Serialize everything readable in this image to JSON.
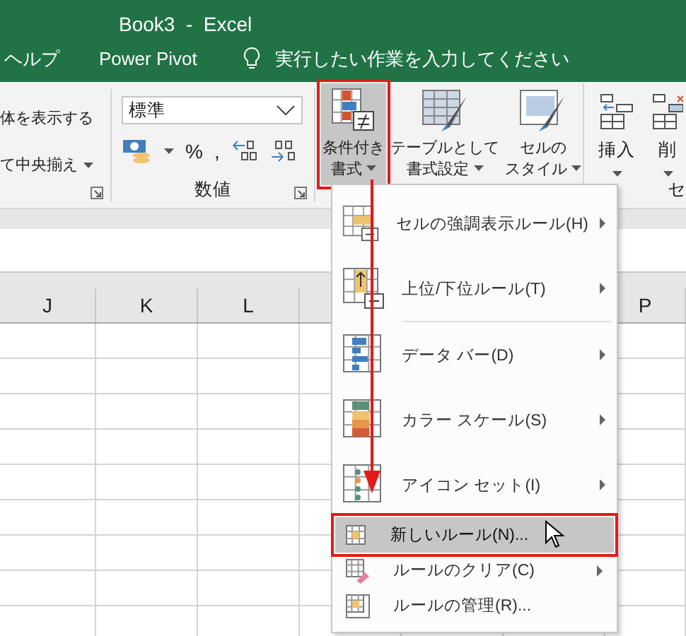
{
  "window": {
    "title": "Book3  -  Excel"
  },
  "tabs": [
    {
      "label": "ヘルプ"
    },
    {
      "label": "Power Pivot"
    }
  ],
  "tell_me": {
    "placeholder": "実行したい作業を入力してください"
  },
  "ribbon": {
    "alignment": {
      "lines": [
        {
          "label": "体を表示する",
          "caret": false
        },
        {
          "label": "て中央揃え",
          "caret": true
        }
      ]
    },
    "number": {
      "format": {
        "value": "標準"
      },
      "buttons": [
        {
          "label": "%",
          "kind": "text"
        },
        {
          "label": ",",
          "kind": "text"
        }
      ],
      "group_label": "数値"
    },
    "styles": [
      {
        "lines": [
          "条件付き",
          "書式"
        ],
        "selected": true
      },
      {
        "lines": [
          "テーブルとして",
          "書式設定"
        ],
        "selected": false
      },
      {
        "lines": [
          "セルの",
          "スタイル"
        ],
        "selected": false
      }
    ],
    "cells": {
      "buttons": [
        {
          "label": "挿入"
        },
        {
          "label": "削"
        }
      ],
      "group_label": "セ"
    }
  },
  "sheet": {
    "columns": [
      "J",
      "K",
      "L",
      "P"
    ]
  },
  "menu": {
    "items": [
      {
        "label": "セルの強調表示ルール(H)",
        "kind": "large",
        "submenu": true,
        "selected": false,
        "separator_after": false
      },
      {
        "label": "上位/下位ルール(T)",
        "kind": "large",
        "submenu": true,
        "selected": false,
        "separator_after": true
      },
      {
        "label": "データ バー(D)",
        "kind": "large",
        "submenu": true,
        "selected": false,
        "separator_after": false
      },
      {
        "label": "カラー スケール(S)",
        "kind": "large",
        "submenu": true,
        "selected": false,
        "separator_after": false
      },
      {
        "label": "アイコン セット(I)",
        "kind": "large",
        "submenu": true,
        "selected": false,
        "separator_after": false
      },
      {
        "label": "新しいルール(N)...",
        "kind": "small",
        "submenu": false,
        "selected": true,
        "separator_after": false
      },
      {
        "label": "ルールのクリア(C)",
        "kind": "small",
        "submenu": true,
        "selected": false,
        "separator_after": false
      },
      {
        "label": "ルールの管理(R)...",
        "kind": "small",
        "submenu": false,
        "selected": false,
        "separator_after": false
      }
    ]
  }
}
